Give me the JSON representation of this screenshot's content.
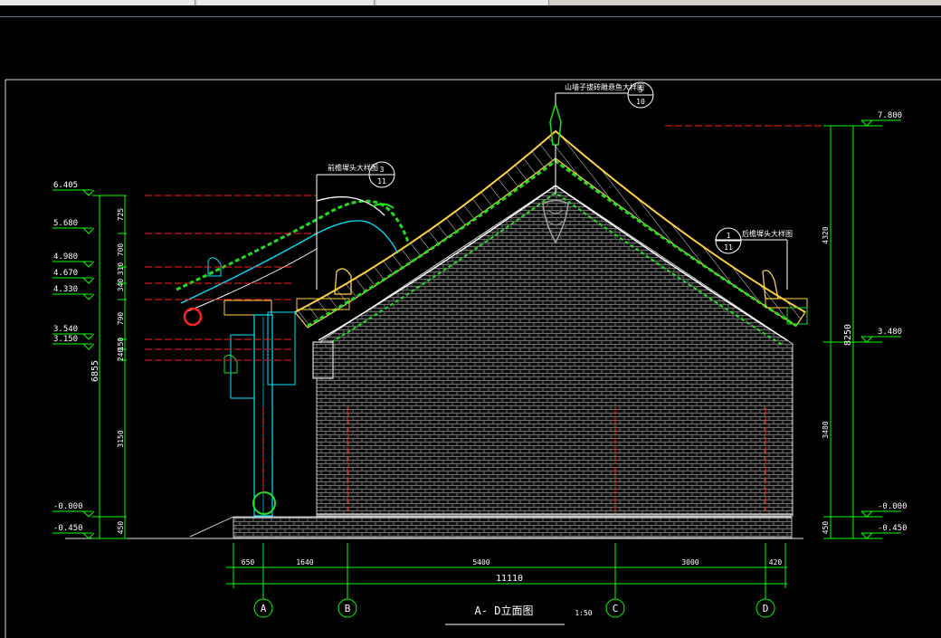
{
  "title": "A- D立面图",
  "scale": "1:50",
  "colors": {
    "background": "#000000",
    "dim_line": "#00ff00",
    "text": "#ffffff",
    "ref_red": "#ff2020",
    "roof_yellow": "#ffd040",
    "green": "#22dd22",
    "cyan": "#00e5ff",
    "wall": "#909090"
  },
  "left_elevations": [
    "6.405",
    "5.680",
    "4.980",
    "4.670",
    "4.330",
    "3.540",
    "3.150",
    "-0.000",
    "-0.450"
  ],
  "left_segments": [
    "725",
    "700",
    "310",
    "340",
    "790",
    "150",
    "240",
    "3150",
    "450"
  ],
  "left_total": "6855",
  "right_elevations": [
    "7.800",
    "3.480",
    "-0.000",
    "-0.450"
  ],
  "right_segments": [
    "4320",
    "3480",
    "450"
  ],
  "right_total": "8250",
  "bottom_dims": [
    "650",
    "1640",
    "5400",
    "3000",
    "420"
  ],
  "bottom_total": "11110",
  "axes": [
    "A",
    "B",
    "C",
    "D"
  ],
  "callouts": [
    {
      "text": "山墙子拔砖雕悬鱼大样图",
      "num": "5",
      "den": "10"
    },
    {
      "text": "前檐墀头大样图",
      "num": "3",
      "den": "11"
    },
    {
      "text": "后檐墀头大样图",
      "num": "1",
      "den": "11"
    }
  ]
}
